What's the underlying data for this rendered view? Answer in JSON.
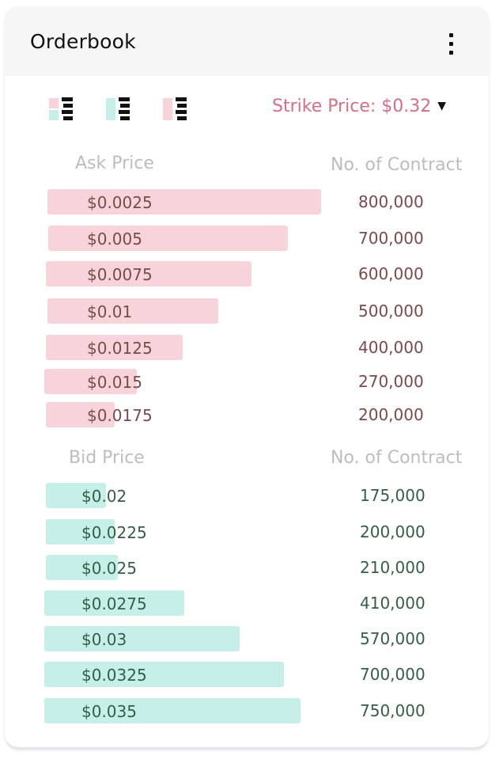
{
  "header": {
    "title": "Orderbook",
    "menu_icon": "kebab-menu-icon"
  },
  "toolbar": {
    "views": [
      {
        "name": "both-sides-view-icon"
      },
      {
        "name": "bids-only-view-icon"
      },
      {
        "name": "asks-only-view-icon"
      }
    ],
    "strike_label": "Strike Price: $0.32",
    "strike_caret": "▼"
  },
  "colors": {
    "ask_bar": "#f6d4da",
    "bid_bar": "#c6efe9",
    "ask_text": "#7a4a4a",
    "bid_text": "#355d47",
    "accent": "#d46f86"
  },
  "asks": {
    "price_header": "Ask Price",
    "qty_header": "No. of Contract",
    "rows": [
      {
        "price": "$0.0025",
        "qty": "800,000",
        "depth": 800000
      },
      {
        "price": "$0.005",
        "qty": "700,000",
        "depth": 700000
      },
      {
        "price": "$0.0075",
        "qty": "600,000",
        "depth": 600000
      },
      {
        "price": "$0.01",
        "qty": "500,000",
        "depth": 500000
      },
      {
        "price": "$0.0125",
        "qty": "400,000",
        "depth": 400000
      },
      {
        "price": "$0.015",
        "qty": "270,000",
        "depth": 270000
      },
      {
        "price": "$0.0175",
        "qty": "200,000",
        "depth": 200000
      }
    ]
  },
  "bids": {
    "price_header": "Bid Price",
    "qty_header": "No. of Contract",
    "rows": [
      {
        "price": "$0.02",
        "qty": "175,000",
        "depth": 175000
      },
      {
        "price": "$0.0225",
        "qty": "200,000",
        "depth": 200000
      },
      {
        "price": "$0.025",
        "qty": "210,000",
        "depth": 210000
      },
      {
        "price": "$0.0275",
        "qty": "410,000",
        "depth": 410000
      },
      {
        "price": "$0.03",
        "qty": "570,000",
        "depth": 570000
      },
      {
        "price": "$0.0325",
        "qty": "700,000",
        "depth": 700000
      },
      {
        "price": "$0.035",
        "qty": "750,000",
        "depth": 750000
      }
    ]
  }
}
